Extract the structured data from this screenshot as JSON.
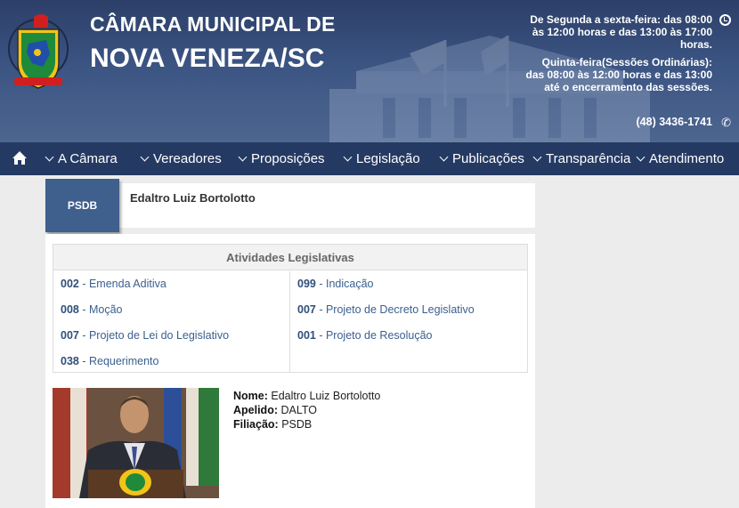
{
  "header": {
    "title_line1": "CÂMARA MUNICIPAL DE",
    "title_line2": "NOVA VENEZA/SC",
    "hours_weekday": "De Segunda a sexta-feira: das 08:00 às 12:00 horas e das 13:00 às 17:00 horas.",
    "hours_thursday": "Quinta-feira(Sessões Ordinárias): das 08:00 às 12:00 horas e das 13:00 até o encerramento das sessões.",
    "phone": "(48) 3436-1741",
    "clock_icon": "clock-icon",
    "phone_icon": "phone-icon"
  },
  "nav": {
    "home_icon": "home-icon",
    "items": [
      {
        "label": "A Câmara"
      },
      {
        "label": "Vereadores"
      },
      {
        "label": "Proposições"
      },
      {
        "label": "Legislação"
      },
      {
        "label": "Publicações"
      },
      {
        "label": "Transparência"
      },
      {
        "label": "Atendimento"
      }
    ]
  },
  "councilor": {
    "party": "PSDB",
    "name": "Edaltro Luiz Bortolotto"
  },
  "activities": {
    "title": "Atividades Legislativas",
    "left": [
      {
        "num": "002",
        "label": "Emenda Aditiva"
      },
      {
        "num": "008",
        "label": "Moção"
      },
      {
        "num": "007",
        "label": "Projeto de Lei do Legislativo"
      },
      {
        "num": "038",
        "label": "Requerimento"
      }
    ],
    "right": [
      {
        "num": "099",
        "label": "Indicação"
      },
      {
        "num": "007",
        "label": "Projeto de Decreto Legislativo"
      },
      {
        "num": "001",
        "label": "Projeto de Resolução"
      }
    ],
    "separator": " - "
  },
  "profile": {
    "name_label": "Nome:",
    "name_value": "Edaltro Luiz Bortolotto",
    "nickname_label": "Apelido:",
    "nickname_value": "DALTO",
    "party_label": "Filiação:",
    "party_value": "PSDB"
  },
  "colors": {
    "nav_bg": "#253a63",
    "party_badge": "#3f5f8c",
    "link": "#3a5f8e"
  }
}
